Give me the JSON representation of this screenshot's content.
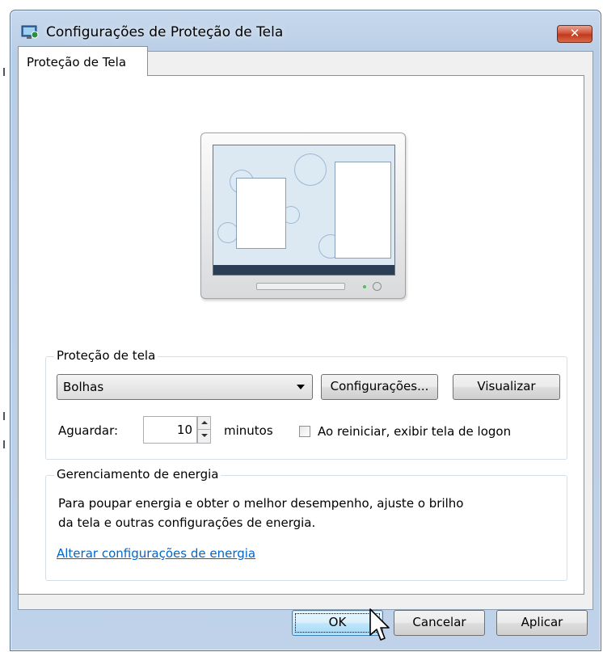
{
  "window": {
    "title": "Configurações de Proteção de Tela",
    "close_label": "✕"
  },
  "tab": {
    "label": "Proteção de Tela"
  },
  "screensaver_group": {
    "legend": "Proteção de tela",
    "selected": "Bolhas",
    "settings_button": "Configurações...",
    "preview_button": "Visualizar",
    "wait_label": "Aguardar:",
    "wait_value": "10",
    "minutes_label": "minutos",
    "logon_checkbox_label": "Ao reiniciar, exibir tela de logon",
    "logon_checked": false
  },
  "power_group": {
    "legend": "Gerenciamento de energia",
    "description_line1": "Para poupar energia e obter o melhor desempenho, ajuste o brilho",
    "description_line2": "da tela e outras configurações de energia.",
    "link": "Alterar configurações de energia"
  },
  "footer": {
    "ok": "OK",
    "cancel": "Cancelar",
    "apply": "Aplicar"
  }
}
